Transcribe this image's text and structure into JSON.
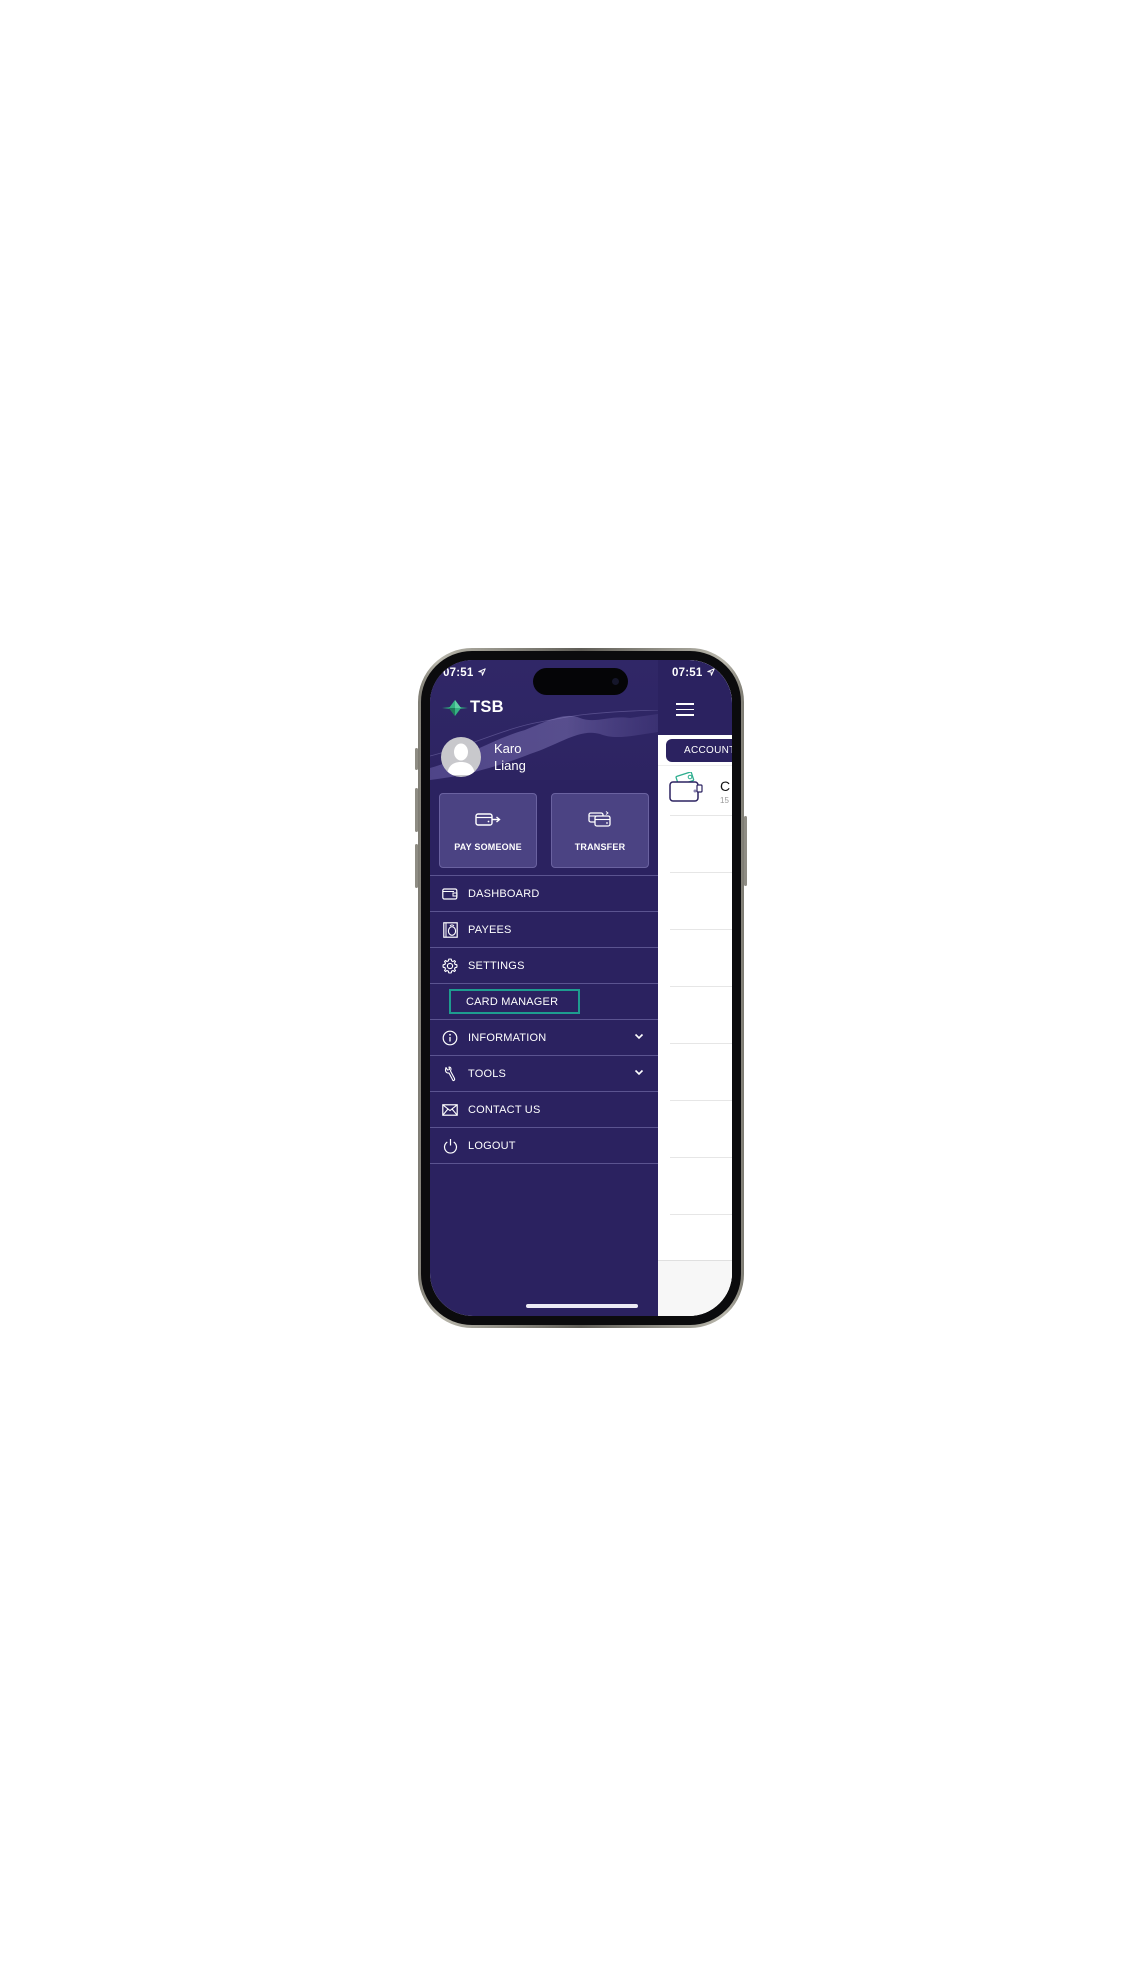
{
  "status_bar": {
    "time_left": "07:51",
    "time_right": "07:51",
    "location_icon": "location-arrow-icon"
  },
  "brand": {
    "logo_text": "TSB",
    "logo_icon": "tsb-diamond-logo-icon",
    "colors": {
      "drawer_bg": "#2b2260",
      "accent_teal": "#1e9c8f",
      "logo_green": "#2fa37a"
    }
  },
  "profile": {
    "first_name": "Karo",
    "last_name": "Liang",
    "avatar_icon": "user-silhouette-icon"
  },
  "quick_actions": [
    {
      "label": "PAY SOMEONE",
      "icon": "card-arrow-right-icon"
    },
    {
      "label": "TRANSFER",
      "icon": "cards-exchange-icon"
    }
  ],
  "menu": {
    "items": [
      {
        "label": "DASHBOARD",
        "icon": "wallet-icon"
      },
      {
        "label": "PAYEES",
        "icon": "payee-book-icon"
      },
      {
        "label": "SETTINGS",
        "icon": "gear-icon"
      },
      {
        "label": "CARD MANAGER",
        "submenu": true,
        "highlighted": true
      },
      {
        "label": "INFORMATION",
        "icon": "info-icon",
        "expandable": true
      },
      {
        "label": "TOOLS",
        "icon": "wrench-icon",
        "expandable": true
      },
      {
        "label": "CONTACT US",
        "icon": "envelope-icon"
      },
      {
        "label": "LOGOUT",
        "icon": "power-icon"
      }
    ]
  },
  "main": {
    "menu_icon": "hamburger-icon",
    "tab_label": "ACCOUNTS",
    "account": {
      "title_initial": "C",
      "subtitle_partial": "15",
      "icon": "wallet-cash-icon"
    }
  }
}
